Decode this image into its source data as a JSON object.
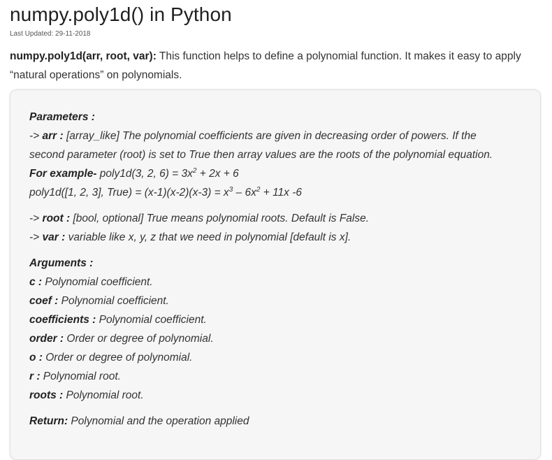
{
  "header": {
    "title": "numpy.poly1d() in Python",
    "last_updated": "Last Updated: 29-11-2018"
  },
  "intro": {
    "signature": "numpy.poly1d(arr, root, var):",
    "text1": " This function helps to define a polynomial function. It makes it easy to apply",
    "text2": "“natural operations” on polynomials."
  },
  "parameters": {
    "heading": "Parameters :",
    "arr_prefix": "-> ",
    "arr_name": "arr :",
    "arr_desc1": " [array_like] The polynomial coefficients are given in decreasing order of powers. If the",
    "arr_desc2": "second parameter (root) is set to True then array values are the roots of the polynomial equation.",
    "example_label": "For example-",
    "example1_pre": " poly1d(3, 2, 6) = 3x",
    "example1_exp": "2",
    "example1_post": " + 2x + 6",
    "example2_pre": "poly1d([1, 2, 3], True) = (x-1)(x-2)(x-3) = x",
    "example2_exp1": "3",
    "example2_mid": " – 6x",
    "example2_exp2": "2",
    "example2_post": " + 11x -6",
    "root_prefix": "-> ",
    "root_name": "root :",
    "root_desc": " [bool, optional] True means polynomial roots. Default is False.",
    "var_prefix": "-> ",
    "var_name": "var :",
    "var_desc": " variable like x, y, z that we need in polynomial [default is x]."
  },
  "arguments": {
    "heading": "Arguments :",
    "items": [
      {
        "name": "c :",
        "desc": " Polynomial coefficient."
      },
      {
        "name": "coef :",
        "desc": " Polynomial coefficient."
      },
      {
        "name": "coefficients :",
        "desc": " Polynomial coefficient."
      },
      {
        "name": "order :",
        "desc": " Order or degree of polynomial."
      },
      {
        "name": "o :",
        "desc": " Order or degree of polynomial."
      },
      {
        "name": "r :",
        "desc": " Polynomial root."
      },
      {
        "name": "roots :",
        "desc": " Polynomial root."
      }
    ]
  },
  "return": {
    "label": "Return:",
    "text": " Polynomial and the operation applied"
  }
}
